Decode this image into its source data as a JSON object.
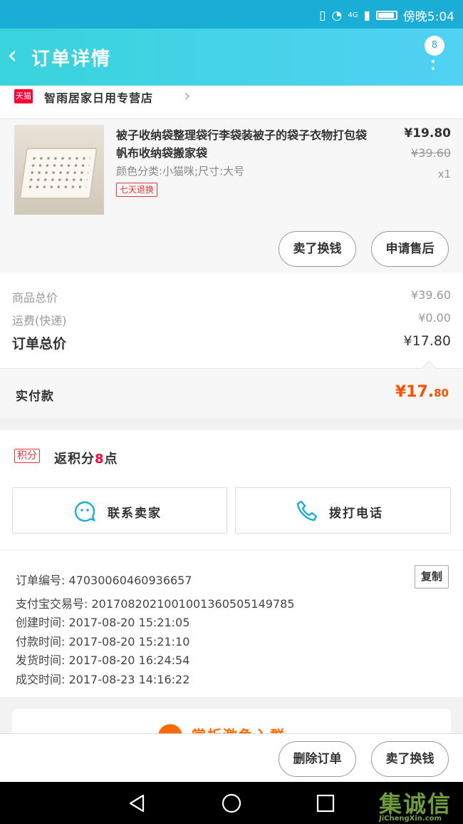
{
  "status_bar": {
    "network": "4G",
    "time": "傍晚5:04"
  },
  "header": {
    "back_glyph": "‹",
    "title": "订单详情",
    "badge_count": "8"
  },
  "store": {
    "platform_badge": "天猫",
    "name": "智雨居家日用专营店",
    "chevron": "›"
  },
  "item": {
    "title": "被子收纳袋整理袋行李袋装被子的袋子衣物打包袋帆布收纳袋搬家袋",
    "sku": "颜色分类:小猫咪;尺寸:大号",
    "service_tag": "七天退换",
    "price": "¥19.80",
    "original_price": "¥39.60",
    "quantity": "x1",
    "buttons": [
      "卖了换钱",
      "申请售后"
    ]
  },
  "totals": {
    "goods_label": "商品总价",
    "goods_value": "¥39.60",
    "shipping_label": "运费(快递)",
    "shipping_value": "¥0.00",
    "order_label": "订单总价",
    "order_value": "¥17.80",
    "paid_label": "实付款",
    "paid_int": "¥17.",
    "paid_dec": "80"
  },
  "points": {
    "badge": "积分",
    "prefix": "返积分",
    "count": "8",
    "suffix": "点"
  },
  "contact": {
    "chat_label": "联系卖家",
    "phone_label": "拨打电话"
  },
  "meta": {
    "order_no": "订单编号: 47030060460936657",
    "alipay_no": "支付宝交易号: 2017082021001001360505149785",
    "created": "创建时间: 2017-08-20 15:21:05",
    "paid": "付款时间: 2017-08-20 15:21:10",
    "shipped": "发货时间: 2017-08-20 16:24:54",
    "completed": "成交时间: 2017-08-23 14:16:22",
    "copy_label": "复制"
  },
  "promo": {
    "text": "赏折激龟入群"
  },
  "footer": {
    "delete_label": "删除订单",
    "sell_label": "卖了换钱"
  },
  "watermark": {
    "text": "集诚信",
    "sub": "JiChengXin.com"
  },
  "colors": {
    "header_start": "#38d3dc",
    "header_end": "#51d2f3",
    "price_orange": "#ff5000",
    "tmall_red": "#ff0036"
  }
}
